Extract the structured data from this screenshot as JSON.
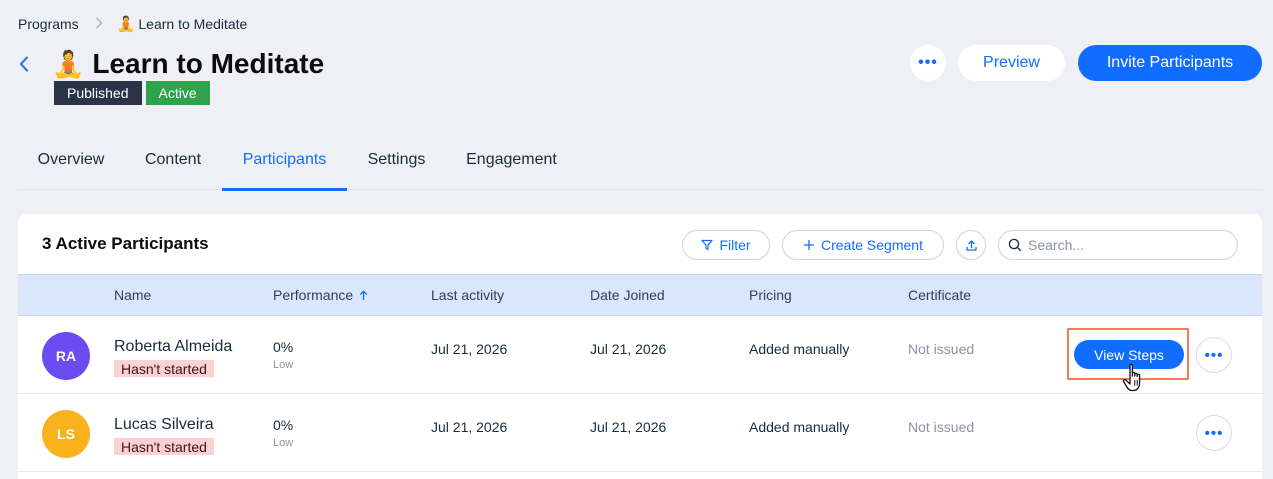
{
  "breadcrumb": {
    "root": "Programs",
    "current_emoji": "🧘",
    "current": "Learn to Meditate"
  },
  "header": {
    "title_emoji": "🧘",
    "title": "Learn to Meditate",
    "badges": [
      "Published",
      "Active"
    ],
    "more_label": "•••",
    "preview_label": "Preview",
    "invite_label": "Invite Participants"
  },
  "tabs": [
    {
      "label": "Overview"
    },
    {
      "label": "Content"
    },
    {
      "label": "Participants",
      "active": true
    },
    {
      "label": "Settings"
    },
    {
      "label": "Engagement"
    }
  ],
  "participants": {
    "heading": "3 Active Participants",
    "filter_label": "Filter",
    "segment_label": "Create Segment",
    "search_placeholder": "Search...",
    "columns": {
      "name": "Name",
      "performance": "Performance",
      "last_activity": "Last activity",
      "date_joined": "Date Joined",
      "pricing": "Pricing",
      "certificate": "Certificate"
    },
    "rows": [
      {
        "initials": "RA",
        "avatar_color": "#6a4cf0",
        "name": "Roberta Almeida",
        "status": "Hasn't started",
        "performance": "0%",
        "performance_level": "Low",
        "last_activity": "Jul 21, 2026",
        "date_joined": "Jul 21, 2026",
        "pricing": "Added manually",
        "certificate": "Not issued",
        "action_label": "View Steps",
        "more_label": "•••"
      },
      {
        "initials": "LS",
        "avatar_color": "#f9b21d",
        "name": "Lucas Silveira",
        "status": "Hasn't started",
        "performance": "0%",
        "performance_level": "Low",
        "last_activity": "Jul 21, 2026",
        "date_joined": "Jul 21, 2026",
        "pricing": "Added manually",
        "certificate": "Not issued",
        "more_label": "•••"
      }
    ]
  },
  "colors": {
    "accent": "#116dff",
    "published_badge": "#2b3447",
    "active_badge": "#2fa34c",
    "status_chip": "#fbd2d2",
    "highlight_outline": "#f07c5c"
  },
  "icons": {
    "breadcrumb_separator": "chevron-right-icon",
    "back": "chevron-left-icon",
    "filter": "filter-icon",
    "segment": "plus-icon",
    "export": "upload-icon",
    "search": "search-icon",
    "sort": "arrow-up-icon",
    "cursor": "hand-pointer-icon"
  }
}
